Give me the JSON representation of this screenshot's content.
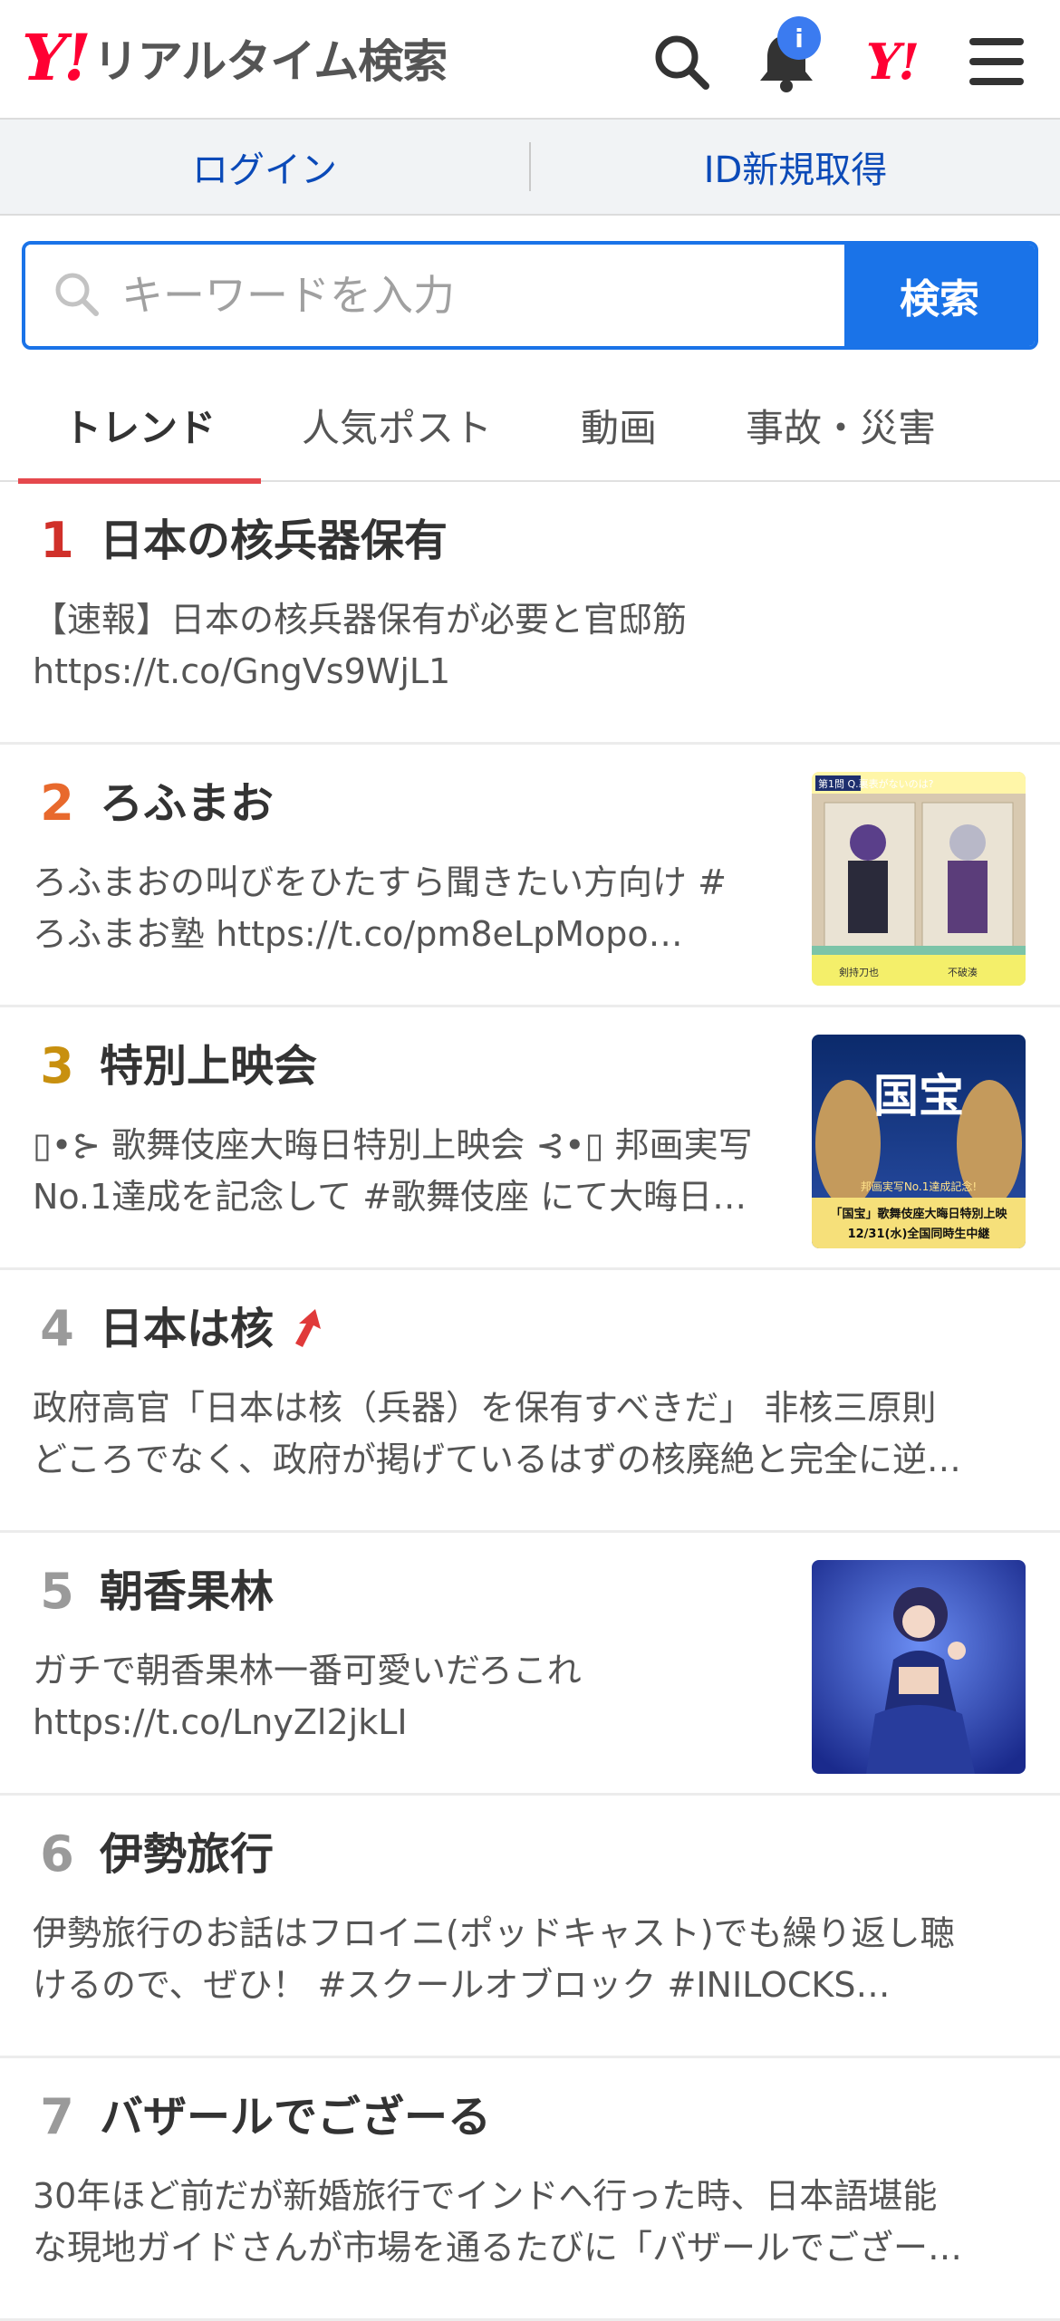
{
  "header": {
    "logo_mark": "Y!",
    "logo_title": "リアルタイム検索",
    "notification_badge": "i",
    "yahoo_icon_text": "Y!"
  },
  "login_bar": {
    "login_label": "ログイン",
    "register_label": "ID新規取得"
  },
  "search": {
    "placeholder": "キーワードを入力",
    "button_label": "検索"
  },
  "tabs": [
    {
      "label": "トレンド",
      "active": true
    },
    {
      "label": "人気ポスト",
      "active": false
    },
    {
      "label": "動画",
      "active": false
    },
    {
      "label": "事故・災害",
      "active": false
    }
  ],
  "trends": [
    {
      "rank": "1",
      "title": "日本の核兵器保有",
      "desc1": "【速報】日本の核兵器保有が必要と官邸筋",
      "desc2": "https://t.co/GngVs9WjL1",
      "thumb": "none"
    },
    {
      "rank": "2",
      "title": "ろふまお",
      "desc1": "ろふまおの叫びをひたすら聞きたい方向け #",
      "desc2": "ろふまお塾 https://t.co/pm8eLpMopo…",
      "thumb": "variety-show"
    },
    {
      "rank": "3",
      "title": "特別上映会",
      "desc1": "▯•⊱ 歌舞伎座大晦日特別上映会 ⊰•▯ 邦画実写",
      "desc2": "No.1達成を記念して #歌舞伎座 にて大晦日…",
      "thumb": "kabuki-poster"
    },
    {
      "rank": "4",
      "title": "日本は核",
      "desc1": "政府高官「日本は核（兵器）を保有すべきだ」 非核三原則",
      "desc2": "どころでなく、政府が掲げているはずの核廃絶と完全に逆…",
      "thumb": "none",
      "trend_up": true
    },
    {
      "rank": "5",
      "title": "朝香果林",
      "desc1": "ガチで朝香果林一番可愛いだろこれ",
      "desc2": "https://t.co/LnyZl2jkLI",
      "thumb": "figure"
    },
    {
      "rank": "6",
      "title": "伊勢旅行",
      "desc1": "伊勢旅行のお話はフロイニ(ポッドキャスト)でも繰り返し聴",
      "desc2": "けるので、ぜひ！ #スクールオブロック #INILOCKS…",
      "thumb": "none"
    },
    {
      "rank": "7",
      "title": "バザールでござーる",
      "desc1": "30年ほど前だが新婚旅行でインドへ行った時、日本語堪能",
      "desc2": "な現地ガイドさんが市場を通るたびに「バザールでござー…",
      "thumb": "none"
    }
  ],
  "thumb_text": {
    "t2_banner": "第1問 Q.裏表がないのは?",
    "t2_name_left": "剣持刀也",
    "t2_name_right": "不破湊",
    "t3_big": "国宝",
    "t3_line1": "邦画実写No.1達成記念!",
    "t3_line2": "「国宝」歌舞伎座大晦日特別上映",
    "t3_line3": "12/31(水)全国同時生中継"
  },
  "colors": {
    "accent_blue": "#1a73e8",
    "tab_underline": "#e5484d",
    "yahoo_red": "#ff0033"
  }
}
